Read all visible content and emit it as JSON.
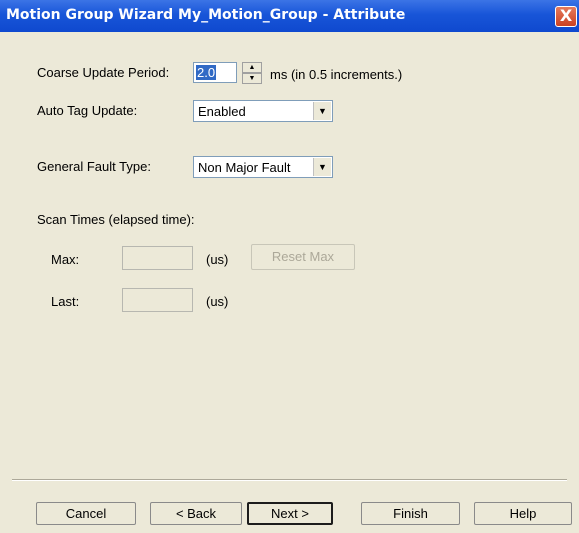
{
  "window": {
    "title": "Motion Group Wizard My_Motion_Group - Attribute",
    "close_glyph": "X"
  },
  "form": {
    "coarse_update": {
      "label": "Coarse Update Period:",
      "value": "2.0",
      "units": "ms (in 0.5 increments.)"
    },
    "auto_tag_update": {
      "label": "Auto Tag Update:",
      "value": "Enabled"
    },
    "general_fault_type": {
      "label": "General Fault Type:",
      "value": "Non Major Fault"
    },
    "scan_times": {
      "label": "Scan Times (elapsed time):",
      "max_label": "Max:",
      "max_unit": "(us)",
      "max_value": "",
      "last_label": "Last:",
      "last_unit": "(us)",
      "last_value": "",
      "reset_max_label": "Reset Max"
    }
  },
  "buttons": {
    "cancel": "Cancel",
    "back": "< Back",
    "next": "Next >",
    "finish": "Finish",
    "help": "Help"
  },
  "icons": {
    "spin_up": "spin-up-icon",
    "spin_down": "spin-down-icon",
    "dropdown_arrow": "dropdown-arrow-icon"
  },
  "colors": {
    "titlebar": "#0f49cf",
    "dialog_bg": "#ece9d8",
    "selection": "#316ac5"
  }
}
